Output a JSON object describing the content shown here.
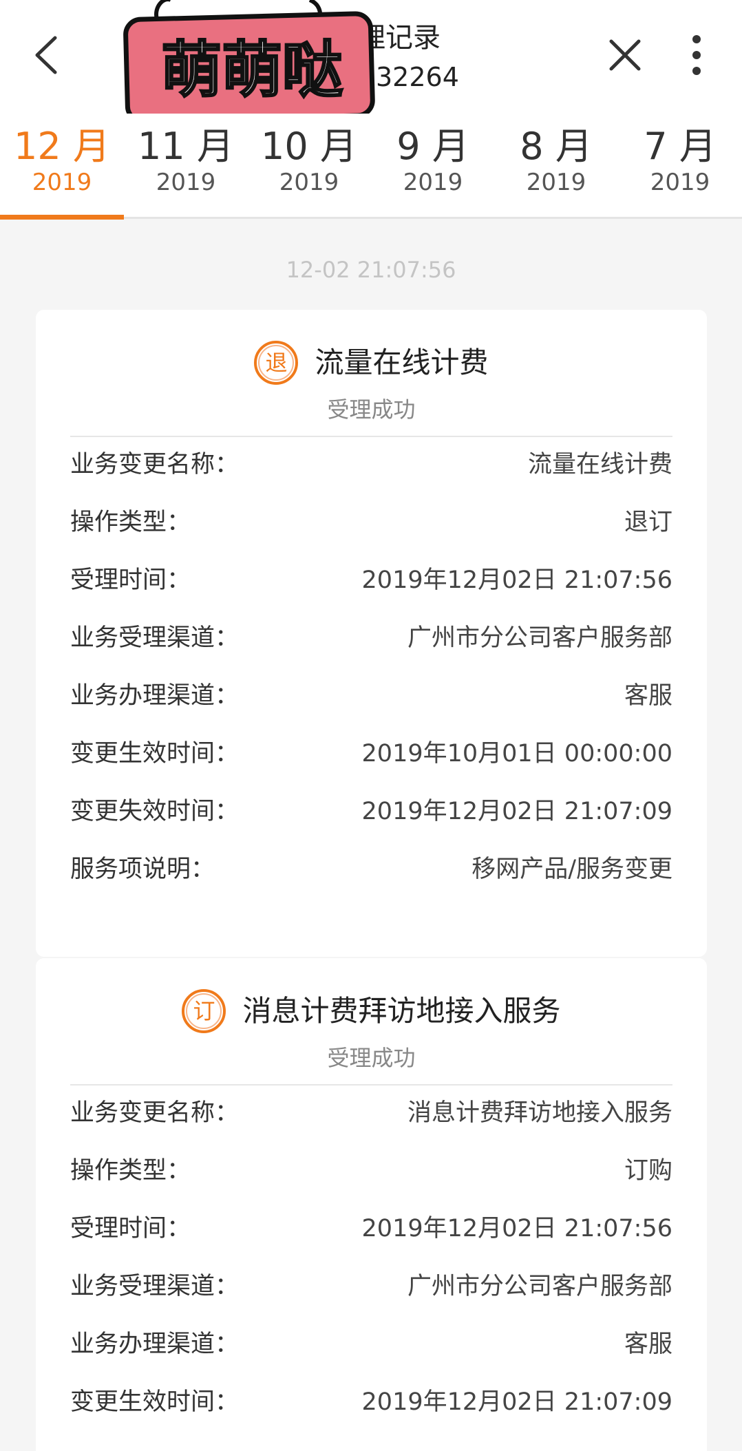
{
  "header": {
    "title_partial": "理记录",
    "subtitle_partial": "32264",
    "sticker_text": "萌萌哒"
  },
  "months": [
    {
      "month": "12 月",
      "year": "2019",
      "active": true
    },
    {
      "month": "11 月",
      "year": "2019",
      "active": false
    },
    {
      "month": "10 月",
      "year": "2019",
      "active": false
    },
    {
      "month": "9 月",
      "year": "2019",
      "active": false
    },
    {
      "month": "8 月",
      "year": "2019",
      "active": false
    },
    {
      "month": "7 月",
      "year": "2019",
      "active": false
    }
  ],
  "timestamp": "12-02 21:07:56",
  "accent_color": "#f07a1b",
  "records": [
    {
      "badge": "退",
      "title": "流量在线计费",
      "status": "受理成功",
      "rows": [
        {
          "label": "业务变更名称：",
          "value": "流量在线计费"
        },
        {
          "label": "操作类型：",
          "value": "退订"
        },
        {
          "label": "受理时间：",
          "value": "2019年12月02日 21:07:56"
        },
        {
          "label": "业务受理渠道：",
          "value": "广州市分公司客户服务部"
        },
        {
          "label": "业务办理渠道：",
          "value": "客服"
        },
        {
          "label": "变更生效时间：",
          "value": "2019年10月01日 00:00:00"
        },
        {
          "label": "变更失效时间：",
          "value": "2019年12月02日 21:07:09"
        },
        {
          "label": "服务项说明：",
          "value": "移网产品/服务变更"
        }
      ]
    },
    {
      "badge": "订",
      "title": "消息计费拜访地接入服务",
      "status": "受理成功",
      "rows": [
        {
          "label": "业务变更名称：",
          "value": "消息计费拜访地接入服务"
        },
        {
          "label": "操作类型：",
          "value": "订购"
        },
        {
          "label": "受理时间：",
          "value": "2019年12月02日 21:07:56"
        },
        {
          "label": "业务受理渠道：",
          "value": "广州市分公司客户服务部"
        },
        {
          "label": "业务办理渠道：",
          "value": "客服"
        },
        {
          "label": "变更生效时间：",
          "value": "2019年12月02日 21:07:09"
        }
      ]
    }
  ]
}
